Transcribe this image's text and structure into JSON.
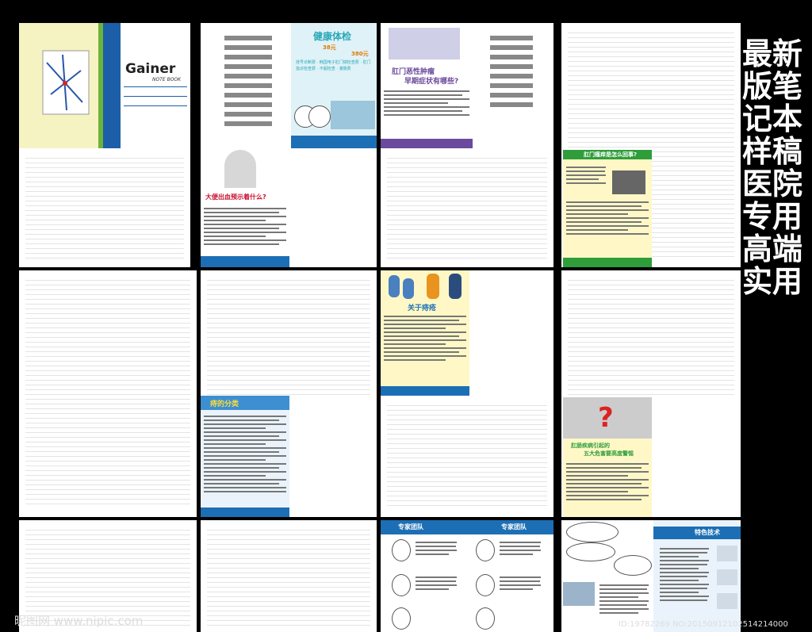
{
  "cover": {
    "brand": "Gainer",
    "sub": "NOTE BOOK"
  },
  "p_checkup": {
    "title": "健康体检",
    "price1": "38元",
    "price2": "380元",
    "items": "挂号诊断费 · 韩国电子肛门镜检查费 · 肛门指诊检查费 · 不超检查 · 灌肠费"
  },
  "p_bleed": {
    "title": "大便出血预示着什么?"
  },
  "p_cancer": {
    "title1": "肛门恶性肿瘤",
    "title2": "早期症状有哪些?"
  },
  "p_itch": {
    "title": "肛门瘙痒是怎么回事?"
  },
  "p_about": {
    "title": "关于痔疮"
  },
  "p_types": {
    "title": "痔的分类"
  },
  "p_q": {
    "title1": "肛肠疾病引起的",
    "title2": "五大危害要高度警惕"
  },
  "p_team": {
    "title": "专家团队"
  },
  "p_tech": {
    "title": "特色技术"
  },
  "right_caption": "最新版笔记本样稿 医院专用 高端实用",
  "watermark_left": "昵图网 www.nipic.com",
  "watermark_right": "ID:19782269 NO:20150912102514214000",
  "colors": {
    "blue": "#1c6fb5",
    "green": "#2e9d3a",
    "purple": "#6a4a9c",
    "yellow": "#fff8c6",
    "teal": "#2aa7b8"
  }
}
